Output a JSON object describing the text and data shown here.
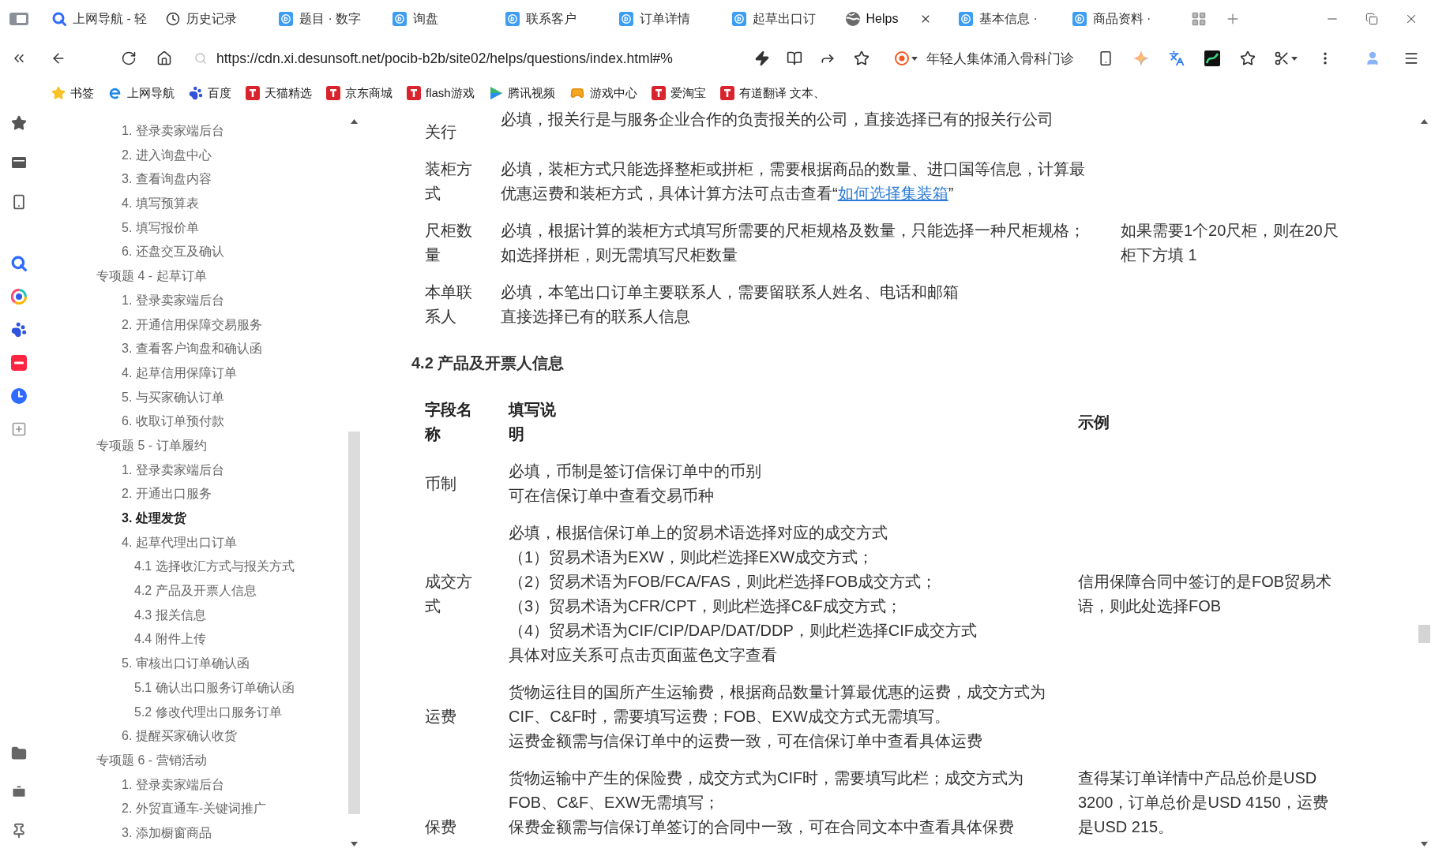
{
  "tabs": [
    {
      "label": "上网导航 - 轻",
      "kind": "search",
      "selected": false
    },
    {
      "label": "历史记录",
      "kind": "history",
      "selected": false
    },
    {
      "label": "题目 · 数字",
      "kind": "app",
      "selected": false
    },
    {
      "label": "询盘",
      "kind": "app",
      "selected": false
    },
    {
      "label": "联系客户",
      "kind": "app",
      "selected": false
    },
    {
      "label": "订单详情",
      "kind": "app",
      "selected": false
    },
    {
      "label": "起草出口订",
      "kind": "app",
      "selected": false
    },
    {
      "label": "Helps",
      "kind": "page",
      "selected": true
    },
    {
      "label": "基本信息 ·",
      "kind": "app",
      "selected": false
    },
    {
      "label": "商品资料 ·",
      "kind": "app",
      "selected": false
    }
  ],
  "address_bar": {
    "url": "https://cdn.xi.desunsoft.net/pocib-b2b/site02/helps/questions/index.html#%",
    "search_suggestion": "年轻人集体涌入骨科门诊"
  },
  "bookmarks": [
    {
      "label": "书签",
      "kind": "star"
    },
    {
      "label": "上网导航",
      "kind": "browser"
    },
    {
      "label": "百度",
      "kind": "paw"
    },
    {
      "label": "天猫精选",
      "kind": "tile"
    },
    {
      "label": "京东商城",
      "kind": "tile"
    },
    {
      "label": "flash游戏",
      "kind": "tile"
    },
    {
      "label": "腾讯视频",
      "kind": "play"
    },
    {
      "label": "游戏中心",
      "kind": "controller"
    },
    {
      "label": "爱淘宝",
      "kind": "tile"
    },
    {
      "label": "有道翻译 文本、",
      "kind": "tile"
    }
  ],
  "tree": [
    {
      "children": [
        {
          "label": "1. 登录卖家端后台",
          "selected": false
        },
        {
          "label": "2. 进入询盘中心",
          "selected": false
        },
        {
          "label": "3. 查看询盘内容",
          "selected": false
        },
        {
          "label": "4. 填写预算表",
          "selected": false
        },
        {
          "label": "5. 填写报价单",
          "selected": false
        },
        {
          "label": "6. 还盘交互及确认",
          "selected": false
        }
      ]
    },
    {
      "label": "专项题 4 - 起草订单",
      "selected": false,
      "children": [
        {
          "label": "1. 登录卖家端后台",
          "selected": false
        },
        {
          "label": "2. 开通信用保障交易服务",
          "selected": false
        },
        {
          "label": "3. 查看客户询盘和确认函",
          "selected": false
        },
        {
          "label": "4. 起草信用保障订单",
          "selected": false
        },
        {
          "label": "5. 与买家确认订单",
          "selected": false
        },
        {
          "label": "6. 收取订单预付款",
          "selected": false
        }
      ]
    },
    {
      "label": "专项题 5 - 订单履约",
      "selected": false,
      "children": [
        {
          "label": "1. 登录卖家端后台",
          "selected": false
        },
        {
          "label": "2. 开通出口服务",
          "selected": false
        },
        {
          "label": "3. 处理发货",
          "selected": true
        },
        {
          "label": "4. 起草代理出口订单",
          "selected": false,
          "children": [
            {
              "label": "4.1 选择收汇方式与报关方式",
              "selected": false
            },
            {
              "label": "4.2 产品及开票人信息",
              "selected": false
            },
            {
              "label": "4.3 报关信息",
              "selected": false
            },
            {
              "label": "4.4 附件上传",
              "selected": false
            }
          ]
        },
        {
          "label": "5. 审核出口订单确认函",
          "selected": false,
          "children": [
            {
              "label": "5.1 确认出口服务订单确认函",
              "selected": false
            },
            {
              "label": "5.2 修改代理出口服务订单",
              "selected": false
            }
          ]
        },
        {
          "label": "6. 提醒买家确认收货",
          "selected": false
        }
      ]
    },
    {
      "label": "专项题 6 - 营销活动",
      "selected": false,
      "children": [
        {
          "label": "1. 登录卖家端后台",
          "selected": false
        },
        {
          "label": "2. 外贸直通车-关键词推广",
          "selected": false
        },
        {
          "label": "3. 添加橱窗商品",
          "selected": false
        }
      ]
    }
  ],
  "content": {
    "table_1": {
      "rows": [
        {
          "column_1": "关行",
          "column_2": [
            "必填，报关行是与服务企业合作的负责报关的公司，直接选择已有的报关行公司"
          ]
        },
        {
          "column_1": "装柜方式",
          "column_2": [
            "必填，装柜方式只能选择整柜或拼柜，需要根据商品的数量、进口国等信息，计算最",
            {
              "text": "优惠运费和装柜方式，具体计算方法可点击查看“",
              "link": "如何选择集装箱",
              "text_after": "”"
            }
          ]
        },
        {
          "column_1": "尺柜数量",
          "column_2": [
            "必填，根据计算的装柜方式填写所需要的尺柜规格及数量，只能选择一种尺柜规格；",
            "如选择拼柜，则无需填写尺柜数量"
          ],
          "column_3": [
            "如果需要1个20尺柜，则在20尺",
            "柜下方填 1"
          ]
        },
        {
          "column_1": "本单联系人",
          "column_2": [
            "必填，本笔出口订单主要联系人，需要留联系人姓名、电话和邮箱",
            "直接选择已有的联系人信息"
          ]
        }
      ]
    },
    "heading": "4.2 产品及开票人信息",
    "table_2": {
      "columns": [
        "字段名称",
        "填写说明",
        "示例"
      ],
      "rows": [
        {
          "field": "币制",
          "instructions": [
            "必填，币制是签订信保订单中的币别",
            "可在信保订单中查看交易币种"
          ]
        },
        {
          "field": "成交方式",
          "instructions": [
            "必填，根据信保订单上的贸易术语选择对应的成交方式",
            "（1）贸易术语为EXW，则此栏选择EXW成交方式；",
            "（2）贸易术语为FOB/FCA/FAS，则此栏选择FOB成交方式；",
            "（3）贸易术语为CFR/CPT，则此栏选择C&F成交方式；",
            "（4）贸易术语为CIF/CIP/DAP/DAT/DDP，则此栏选择CIF成交方式",
            "具体对应关系可点击页面蓝色文字查看"
          ],
          "example": [
            "信用保障合同中签订的是FOB贸易术",
            "语，则此处选择FOB"
          ]
        },
        {
          "field": "运费",
          "instructions": [
            "货物运往目的国所产生运输费，根据商品数量计算最优惠的运费，成交方式为",
            "CIF、C&F时，需要填写运费；FOB、EXW成交方式无需填写。",
            "运费金额需与信保订单中的运费一致，可在信保订单中查看具体运费"
          ]
        },
        {
          "field": "保费",
          "instructions": [
            "货物运输中产生的保险费，成交方式为CIF时，需要填写此栏；成交方式为",
            "FOB、C&F、EXW无需填写；",
            "保费金额需与信保订单签订的合同中一致，可在合同文本中查看具体保费"
          ],
          "example": [
            "查得某订单详情中产品总价是USD",
            "3200，订单总价是USD 4150，运费",
            "是USD 215。"
          ]
        }
      ]
    }
  }
}
